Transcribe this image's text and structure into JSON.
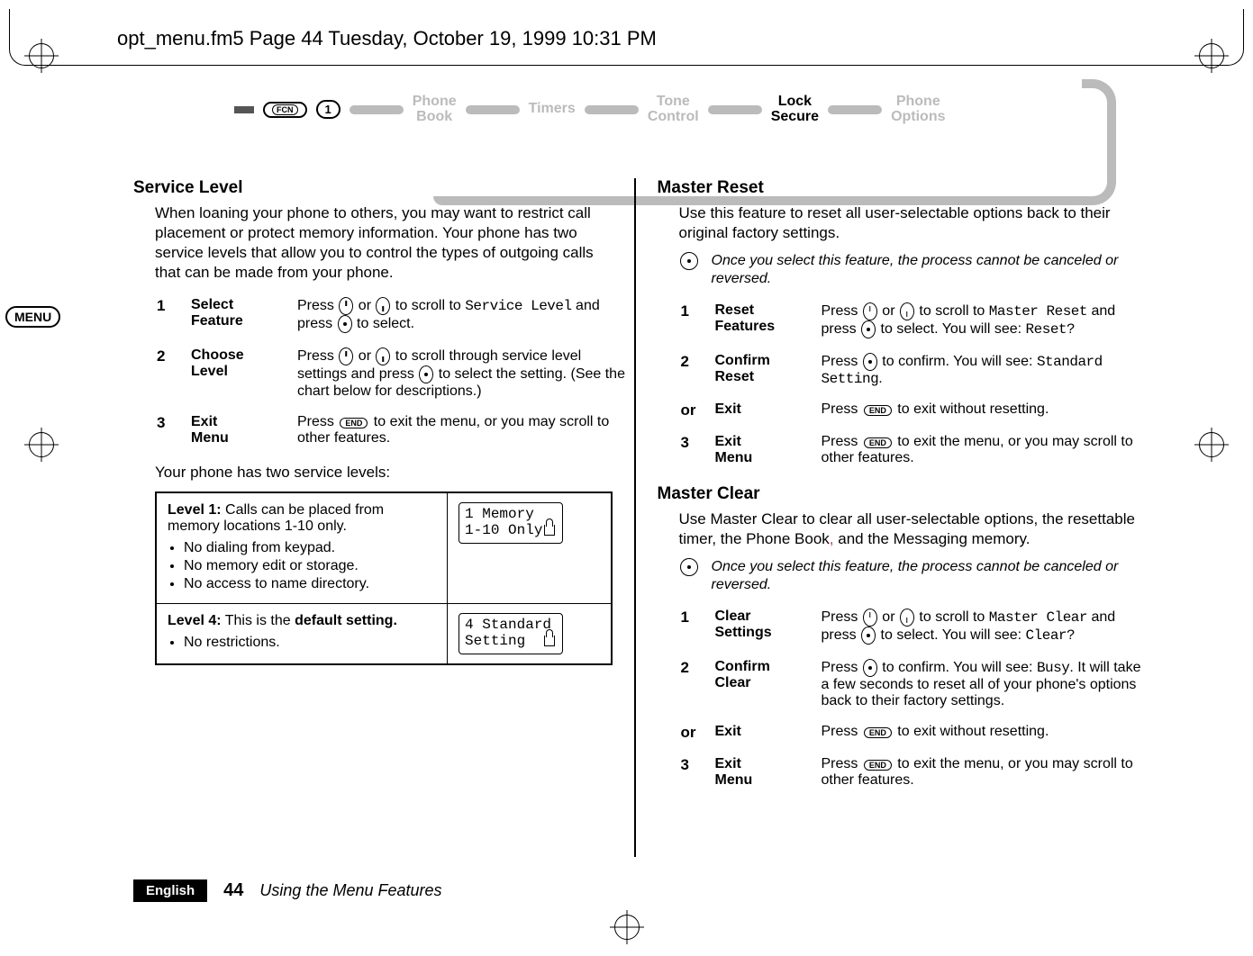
{
  "header": "opt_menu.fm5  Page 44  Tuesday, October 19, 1999  10:31 PM",
  "menu_badge": "MENU",
  "nav": {
    "fcn_key": "FCN",
    "one_key": "1",
    "items": [
      {
        "top": "Phone",
        "bot": "Book",
        "active": false
      },
      {
        "top": "Timers",
        "bot": "",
        "active": false
      },
      {
        "top": "Tone",
        "bot": "Control",
        "active": false
      },
      {
        "top": "Lock",
        "bot": "Secure",
        "active": true
      },
      {
        "top": "Phone",
        "bot": "Options",
        "active": false
      }
    ]
  },
  "left": {
    "heading": "Service Level",
    "intro": "When loaning your phone to others, you may want to restrict call placement or protect memory information. Your phone has two service levels that allow you to control the types of outgoing calls that can be made from your phone.",
    "steps": [
      {
        "num": "1",
        "title": "Select\nFeature",
        "pre": "Press ",
        "mid": " or ",
        "after_scroll": " to scroll to ",
        "mono": "Service Level",
        "tail1": " and press ",
        "tail2": " to select."
      },
      {
        "num": "2",
        "title": "Choose\nLevel",
        "pre": "Press ",
        "mid": " or ",
        "after_scroll": " to scroll through service level settings and press ",
        "tail2": " to select the setting. (See the chart below for descriptions.)"
      },
      {
        "num": "3",
        "title": "Exit\nMenu",
        "pre": "Press ",
        "end": "END",
        "tail": " to exit the menu, or you may scroll to other features."
      }
    ],
    "levels_intro": "Your phone has two service levels:",
    "level1": {
      "title": "Level 1:",
      "desc": " Calls can be placed from memory locations 1-10 only.",
      "bullets": [
        "No dialing from keypad.",
        "No memory edit or storage.",
        "No access to name directory."
      ],
      "lcd": "1 Memory\n1-10 Only"
    },
    "level4": {
      "title": "Level 4:",
      "desc_pre": " This is the ",
      "desc_bold": "default setting.",
      "bullets": [
        "No restrictions."
      ],
      "lcd": "4 Standard\nSetting  "
    }
  },
  "right": {
    "reset": {
      "heading": "Master Reset",
      "intro": "Use this feature to reset all user-selectable options back to their original factory settings.",
      "note": "Once you select this feature, the process cannot be canceled or reversed.",
      "steps": [
        {
          "num": "1",
          "title": "Reset\nFeatures",
          "pre": "Press ",
          "mid": " or ",
          "after": " to scroll to ",
          "mono": "Master Reset",
          "tail_a": " and press ",
          "tail_b": " to select. You will see: ",
          "mono2": "Reset?"
        },
        {
          "num": "2",
          "title": "Confirm\nReset",
          "pre": "Press ",
          "after": " to confirm. You will see: ",
          "mono": "Standard Setting",
          "tail": "."
        },
        {
          "num": "or",
          "title": "Exit",
          "pre": "Press ",
          "end": "END",
          "tail": " to exit without resetting."
        },
        {
          "num": "3",
          "title": "Exit\nMenu",
          "pre": "Press ",
          "end": "END",
          "tail": " to exit the menu, or you may scroll to other features."
        }
      ]
    },
    "clear": {
      "heading": "Master Clear",
      "intro_a": "Use Master Clear to clear all user-selectable options, the resettable timer, the Phone Book",
      "intro_red": ",",
      "intro_b": " and the Messaging memory.",
      "note": "Once you select this feature, the process cannot be canceled or reversed.",
      "steps": [
        {
          "num": "1",
          "title": "Clear\nSettings",
          "pre": "Press ",
          "mid": " or ",
          "after": " to scroll to ",
          "mono": "Master Clear",
          "tail_a": " and press ",
          "tail_b": " to select. You will see: ",
          "mono2": "Clear?"
        },
        {
          "num": "2",
          "title": "Confirm\nClear",
          "pre": "Press ",
          "after": " to confirm. You will see: ",
          "mono": "Busy",
          "tail": ". It will take a few seconds to reset all of your phone's options back to their factory settings."
        },
        {
          "num": "or",
          "title": "Exit",
          "pre": "Press ",
          "end": "END",
          "tail": " to exit without resetting."
        },
        {
          "num": "3",
          "title": "Exit\nMenu",
          "pre": "Press ",
          "end": "END",
          "tail": " to exit the menu, or you may scroll to other features."
        }
      ]
    }
  },
  "footer": {
    "lang": "English",
    "page": "44",
    "section": "Using the Menu Features"
  }
}
